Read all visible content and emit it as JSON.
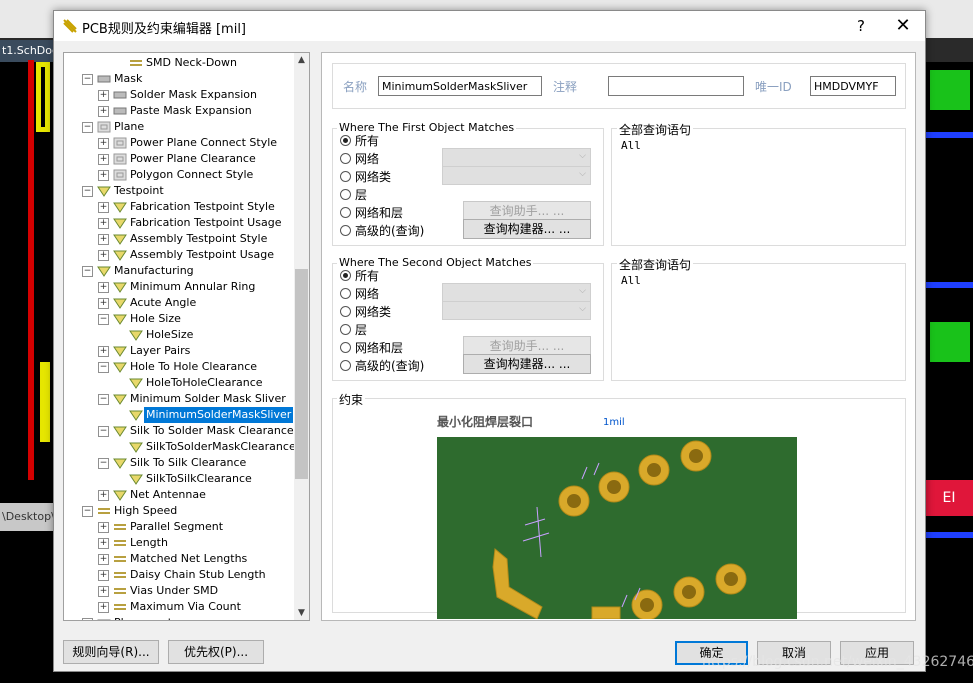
{
  "background": {
    "tab_label": "t1.SchDoc",
    "desktop_label": "\\Desktop\\",
    "red_box_label": "EI"
  },
  "dialog": {
    "title": "PCB规则及约束编辑器 [mil]",
    "help_label": "?",
    "close_label": "✕"
  },
  "tree": {
    "items": [
      {
        "label": "SMD Neck-Down",
        "level": 2,
        "icon": "neckdown-rule-icon"
      },
      {
        "label": "Mask",
        "level": 0,
        "icon": "mask-category-icon"
      },
      {
        "label": "Solder Mask Expansion",
        "level": 1,
        "icon": "mask-rule-icon"
      },
      {
        "label": "Paste Mask Expansion",
        "level": 1,
        "icon": "mask-rule-icon"
      },
      {
        "label": "Plane",
        "level": 0,
        "icon": "plane-category-icon"
      },
      {
        "label": "Power Plane Connect Style",
        "level": 1,
        "icon": "plane-rule-icon"
      },
      {
        "label": "Power Plane Clearance",
        "level": 1,
        "icon": "plane-rule-icon"
      },
      {
        "label": "Polygon Connect Style",
        "level": 1,
        "icon": "plane-rule-icon"
      },
      {
        "label": "Testpoint",
        "level": 0,
        "icon": "testpoint-category-icon"
      },
      {
        "label": "Fabrication Testpoint Style",
        "level": 1,
        "icon": "testpoint-rule-icon"
      },
      {
        "label": "Fabrication Testpoint Usage",
        "level": 1,
        "icon": "testpoint-rule-icon"
      },
      {
        "label": "Assembly Testpoint Style",
        "level": 1,
        "icon": "testpoint-rule-icon"
      },
      {
        "label": "Assembly Testpoint Usage",
        "level": 1,
        "icon": "testpoint-rule-icon"
      },
      {
        "label": "Manufacturing",
        "level": 0,
        "icon": "manufacturing-category-icon"
      },
      {
        "label": "Minimum Annular Ring",
        "level": 1,
        "icon": "manufacturing-rule-icon"
      },
      {
        "label": "Acute Angle",
        "level": 1,
        "icon": "manufacturing-rule-icon"
      },
      {
        "label": "Hole Size",
        "level": 1,
        "icon": "manufacturing-rule-icon"
      },
      {
        "label": "HoleSize",
        "level": 2,
        "icon": "manufacturing-rule-icon"
      },
      {
        "label": "Layer Pairs",
        "level": 1,
        "icon": "manufacturing-rule-icon"
      },
      {
        "label": "Hole To Hole Clearance",
        "level": 1,
        "icon": "manufacturing-rule-icon"
      },
      {
        "label": "HoleToHoleClearance",
        "level": 2,
        "icon": "manufacturing-rule-icon"
      },
      {
        "label": "Minimum Solder Mask Sliver",
        "level": 1,
        "icon": "manufacturing-rule-icon"
      },
      {
        "label": "MinimumSolderMaskSliver",
        "level": 2,
        "icon": "manufacturing-rule-icon",
        "selected": true
      },
      {
        "label": "Silk To Solder Mask Clearance",
        "level": 1,
        "icon": "manufacturing-rule-icon"
      },
      {
        "label": "SilkToSolderMaskClearance",
        "level": 2,
        "icon": "manufacturing-rule-icon"
      },
      {
        "label": "Silk To Silk Clearance",
        "level": 1,
        "icon": "manufacturing-rule-icon"
      },
      {
        "label": "SilkToSilkClearance",
        "level": 2,
        "icon": "manufacturing-rule-icon"
      },
      {
        "label": "Net Antennae",
        "level": 1,
        "icon": "manufacturing-rule-icon"
      },
      {
        "label": "High Speed",
        "level": 0,
        "icon": "highspeed-category-icon"
      },
      {
        "label": "Parallel Segment",
        "level": 1,
        "icon": "highspeed-rule-icon"
      },
      {
        "label": "Length",
        "level": 1,
        "icon": "highspeed-rule-icon"
      },
      {
        "label": "Matched Net Lengths",
        "level": 1,
        "icon": "highspeed-rule-icon"
      },
      {
        "label": "Daisy Chain Stub Length",
        "level": 1,
        "icon": "highspeed-rule-icon"
      },
      {
        "label": "Vias Under SMD",
        "level": 1,
        "icon": "highspeed-rule-icon"
      },
      {
        "label": "Maximum Via Count",
        "level": 1,
        "icon": "highspeed-rule-icon"
      },
      {
        "label": "Placement",
        "level": 0,
        "icon": "placement-category-icon"
      }
    ]
  },
  "rule": {
    "name_label": "名称",
    "name_value": "MinimumSolderMaskSliver",
    "comment_label": "注释",
    "comment_value": "",
    "id_label": "唯一ID",
    "id_value": "HMDDVMYF"
  },
  "first_match": {
    "title": "Where The First Object Matches",
    "options": [
      "所有",
      "网络",
      "网络类",
      "层",
      "网络和层",
      "高级的(查询)"
    ],
    "selected_index": 0,
    "helper_button": "查询助手... ...",
    "builder_button": "查询构建器... ...",
    "query_title": "全部查询语句",
    "query_text": "All"
  },
  "second_match": {
    "title": "Where The Second Object Matches",
    "options": [
      "所有",
      "网络",
      "网络类",
      "层",
      "网络和层",
      "高级的(查询)"
    ],
    "selected_index": 0,
    "helper_button": "查询助手... ...",
    "builder_button": "查询构建器... ...",
    "query_title": "全部查询语句",
    "query_text": "All"
  },
  "constraints": {
    "title": "约束",
    "diagram_title": "最小化阻焊层裂口",
    "value": "1mil",
    "colors": {
      "board": "#2e6b2e",
      "pad": "#d9a92a",
      "dimension": "#c8a0ff"
    }
  },
  "buttons": {
    "rule_wizard": "规则向导(R)...",
    "priorities": "优先权(P)...",
    "ok": "确定",
    "cancel": "取消",
    "apply": "应用"
  },
  "watermark": "https://blog.csdn.net/weixin_43262746"
}
